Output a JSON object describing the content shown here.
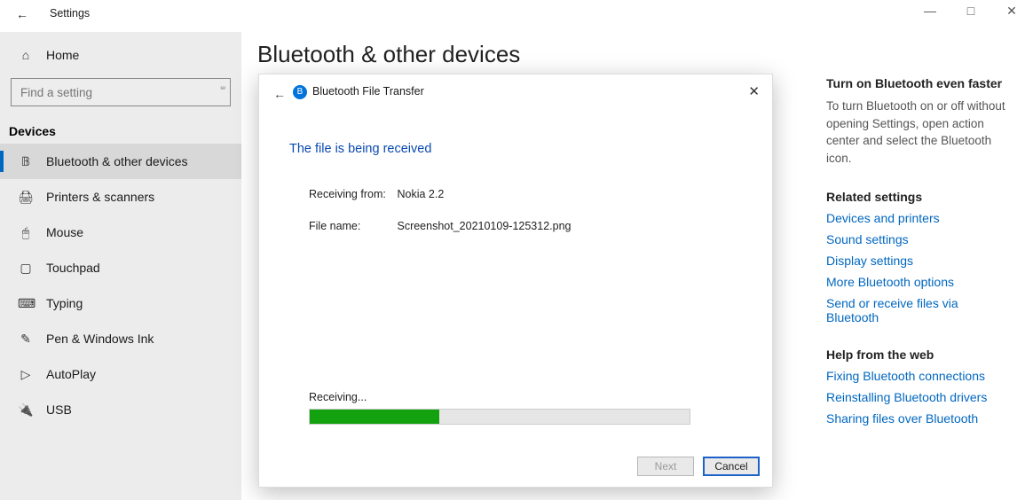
{
  "window": {
    "app_title": "Settings",
    "min_tooltip": "Minimize",
    "max_tooltip": "Restore",
    "close_tooltip": "Close"
  },
  "sidebar": {
    "home_label": "Home",
    "search_placeholder": "Find a setting",
    "section_label": "Devices",
    "items": [
      {
        "icon": "bluetooth",
        "label": "Bluetooth & other devices",
        "selected": true
      },
      {
        "icon": "printer",
        "label": "Printers & scanners",
        "selected": false
      },
      {
        "icon": "mouse",
        "label": "Mouse",
        "selected": false
      },
      {
        "icon": "touchpad",
        "label": "Touchpad",
        "selected": false
      },
      {
        "icon": "keyboard",
        "label": "Typing",
        "selected": false
      },
      {
        "icon": "pen",
        "label": "Pen & Windows Ink",
        "selected": false
      },
      {
        "icon": "autoplay",
        "label": "AutoPlay",
        "selected": false
      },
      {
        "icon": "usb",
        "label": "USB",
        "selected": false
      }
    ]
  },
  "main": {
    "title": "Bluetooth & other devices"
  },
  "right": {
    "tip_heading": "Turn on Bluetooth even faster",
    "tip_body": "To turn Bluetooth on or off without opening Settings, open action center and select the Bluetooth icon.",
    "related_heading": "Related settings",
    "related_links": [
      "Devices and printers",
      "Sound settings",
      "Display settings",
      "More Bluetooth options",
      "Send or receive files via Bluetooth"
    ],
    "help_heading": "Help from the web",
    "help_links": [
      "Fixing Bluetooth connections",
      "Reinstalling Bluetooth drivers",
      "Sharing files over Bluetooth"
    ]
  },
  "dialog": {
    "title": "Bluetooth File Transfer",
    "subtitle": "The file is being received",
    "from_label": "Receiving from:",
    "from_value": "Nokia 2.2",
    "file_label": "File name:",
    "file_value": "Screenshot_20210109-125312.png",
    "receiving_label": "Receiving...",
    "progress_percent": 34,
    "next_label": "Next",
    "cancel_label": "Cancel"
  }
}
